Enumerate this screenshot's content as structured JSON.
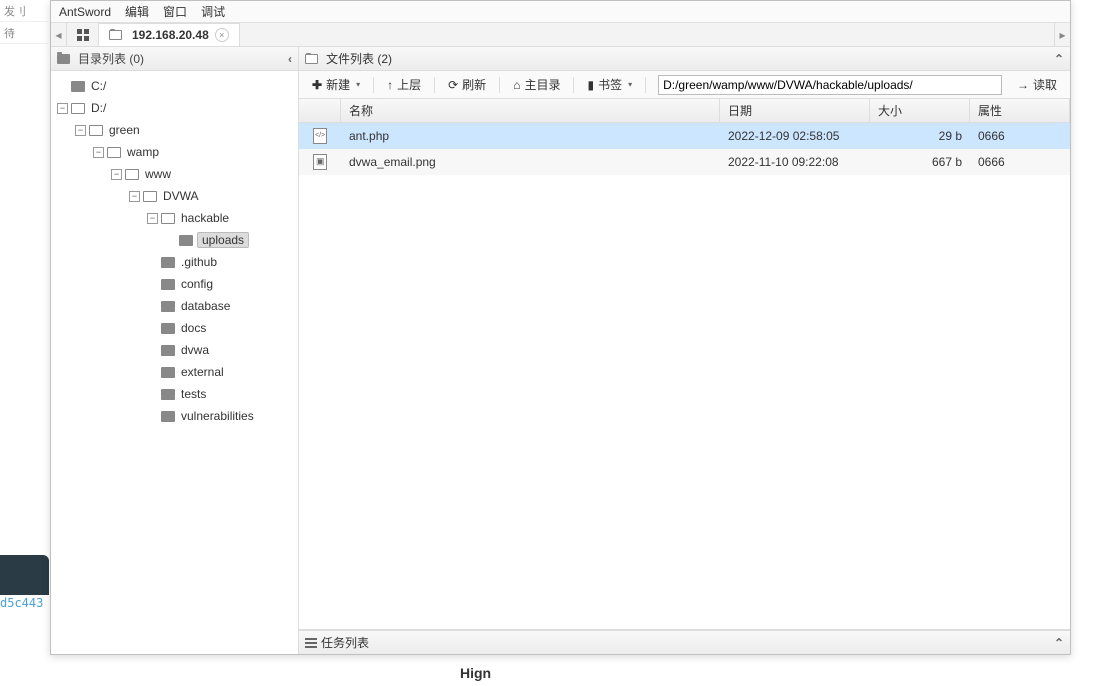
{
  "menu": {
    "title": "AntSword",
    "items": [
      "编辑",
      "窗口",
      "调试"
    ]
  },
  "tab": {
    "address": "192.168.20.48"
  },
  "dirpanel": {
    "title": "目录列表 (0)"
  },
  "tree": {
    "c": "C:/",
    "d": "D:/",
    "green": "green",
    "wamp": "wamp",
    "www": "www",
    "dvwa_dir": "DVWA",
    "hackable": "hackable",
    "uploads": "uploads",
    "github": ".github",
    "config": "config",
    "database": "database",
    "docs": "docs",
    "dvwa": "dvwa",
    "external": "external",
    "tests": "tests",
    "vulnerabilities": "vulnerabilities"
  },
  "filepanel": {
    "title": "文件列表 (2)"
  },
  "toolbar": {
    "new": "新建",
    "up": "上层",
    "refresh": "刷新",
    "home": "主目录",
    "bookmark": "书签",
    "path": "D:/green/wamp/www/DVWA/hackable/uploads/",
    "read": "读取"
  },
  "columns": {
    "name": "名称",
    "date": "日期",
    "size": "大小",
    "attr": "属性"
  },
  "files": [
    {
      "name": "ant.php",
      "date": "2022-12-09 02:58:05",
      "size": "29 b",
      "attr": "0666",
      "type": "code",
      "selected": true
    },
    {
      "name": "dvwa_email.png",
      "date": "2022-11-10 09:22:08",
      "size": "667 b",
      "attr": "0666",
      "type": "img",
      "selected": false
    }
  ],
  "taskbar": {
    "title": "任务列表"
  },
  "ghost": {
    "left0": "发刂",
    "left1": "待",
    "hash": "d5c443",
    "hign": "Hign"
  }
}
